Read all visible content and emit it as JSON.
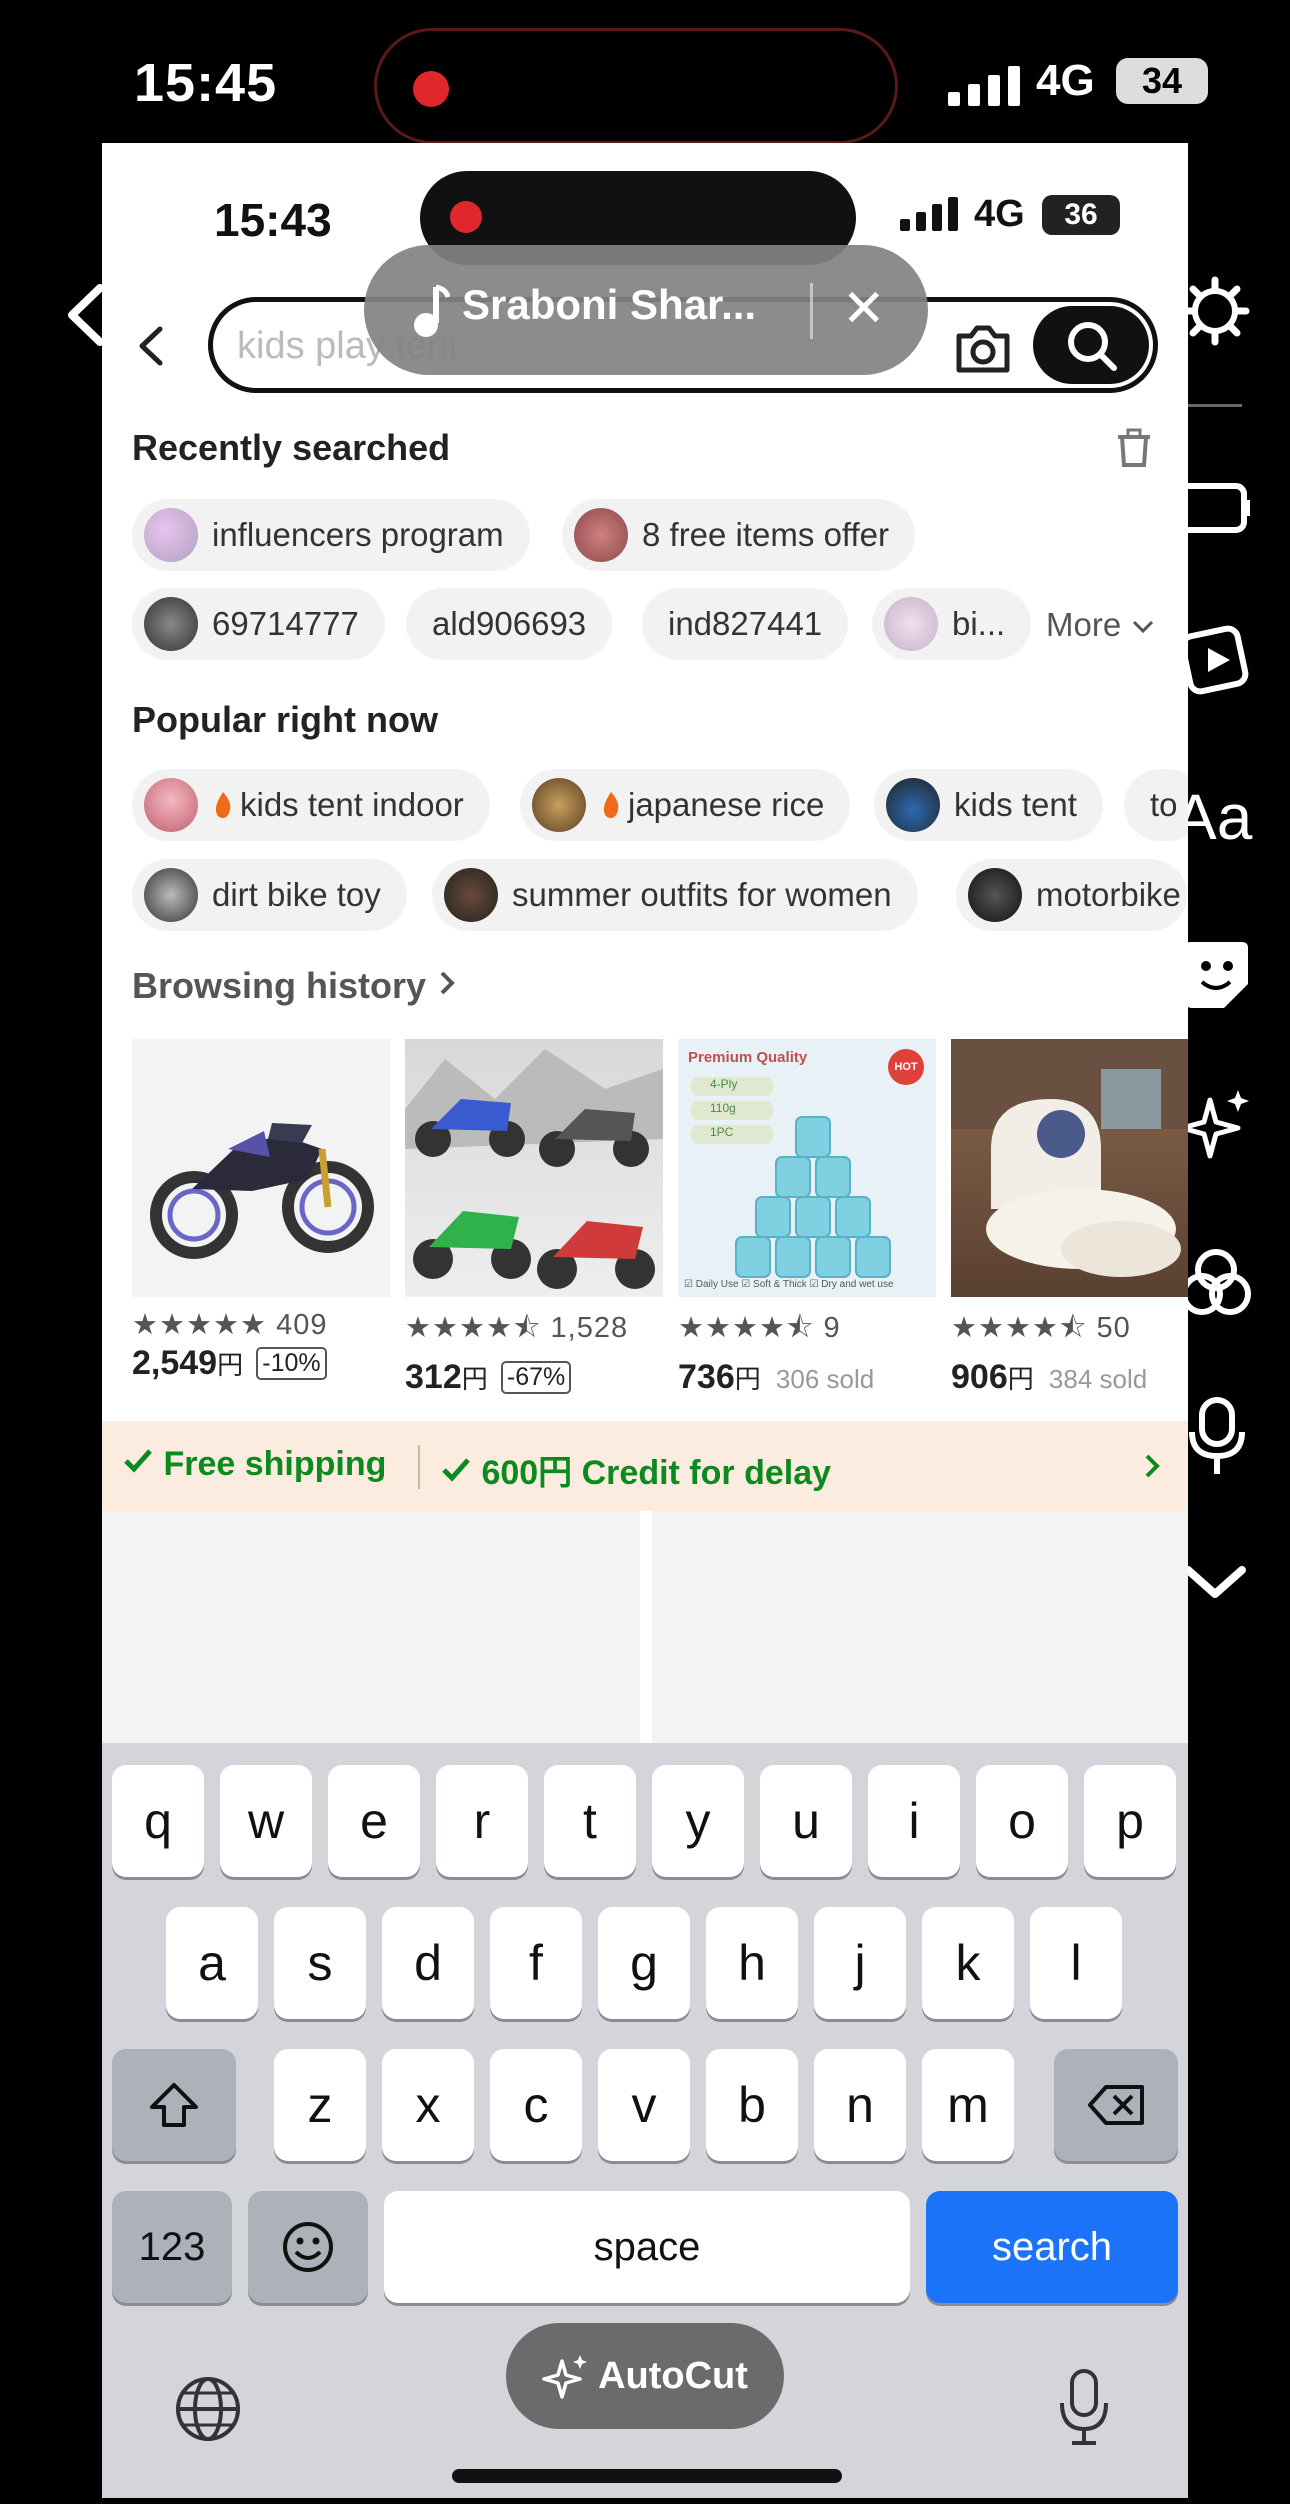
{
  "outer_status": {
    "time": "15:45",
    "network": "4G",
    "battery": "34"
  },
  "inner_status": {
    "time": "15:43",
    "network": "4G",
    "battery": "36"
  },
  "music_pill": {
    "title": "Sraboni Shar..."
  },
  "search": {
    "placeholder": "kids play tent"
  },
  "recent": {
    "title": "Recently searched",
    "chips_row1": [
      "influencers program",
      "8 free items offer"
    ],
    "chips_row2": [
      "69714777",
      "ald906693",
      "ind827441",
      "bi..."
    ],
    "more_label": "More"
  },
  "popular": {
    "title": "Popular right now",
    "chips_row1": [
      "kids tent indoor",
      "japanese rice",
      "kids tent",
      "to"
    ],
    "chips_row2": [
      "dirt bike toy",
      "summer outfits for women",
      "motorbike"
    ]
  },
  "browsing": {
    "title": "Browsing history",
    "products": [
      {
        "rating": 5,
        "reviews": "409",
        "price": "2,549",
        "yen": "円",
        "badge": "-10%",
        "sold": ""
      },
      {
        "rating": 4.5,
        "reviews": "1,528",
        "price": "312",
        "yen": "円",
        "badge": "-67%",
        "sold": ""
      },
      {
        "rating": 4.5,
        "reviews": "9",
        "price": "736",
        "yen": "円",
        "badge": "",
        "sold": "306 sold"
      },
      {
        "rating": 4.5,
        "reviews": "50",
        "price": "906",
        "yen": "円",
        "badge": "",
        "sold": "384 sold"
      }
    ],
    "premium_label": "Premium Quality",
    "tp_tags": [
      "4-Ply",
      "110g",
      "1PC"
    ],
    "tp_footer": "☑ Daily Use  ☑ Soft & Thick  ☑ Dry and wet use",
    "hot": "HOT"
  },
  "shipping": {
    "free": "Free shipping",
    "credit": "600円 Credit for delay"
  },
  "keyboard": {
    "row1": [
      "q",
      "w",
      "e",
      "r",
      "t",
      "y",
      "u",
      "i",
      "o",
      "p"
    ],
    "row2": [
      "a",
      "s",
      "d",
      "f",
      "g",
      "h",
      "j",
      "k",
      "l"
    ],
    "row3": [
      "z",
      "x",
      "c",
      "v",
      "b",
      "n",
      "m"
    ],
    "numbers": "123",
    "space": "space",
    "search": "search"
  },
  "autocut": {
    "label": "AutoCut"
  },
  "sidebar": {
    "text_tool": "Aa"
  },
  "colors": {
    "accent_blue": "#1a73f8",
    "ship_green": "#0b8a1f",
    "ship_bg": "#fbecdf",
    "record_red": "#e0272b"
  },
  "icons": [
    "back-arrow-icon",
    "camera-icon",
    "search-icon",
    "trash-icon",
    "chevron-down-icon",
    "chevron-right-icon",
    "check-icon",
    "shift-icon",
    "backspace-icon",
    "emoji-icon",
    "globe-icon",
    "mic-icon",
    "music-note-icon",
    "close-icon",
    "sparkle-icon",
    "settings-icon",
    "sticker-icon",
    "effects-icon",
    "voice-icon"
  ]
}
